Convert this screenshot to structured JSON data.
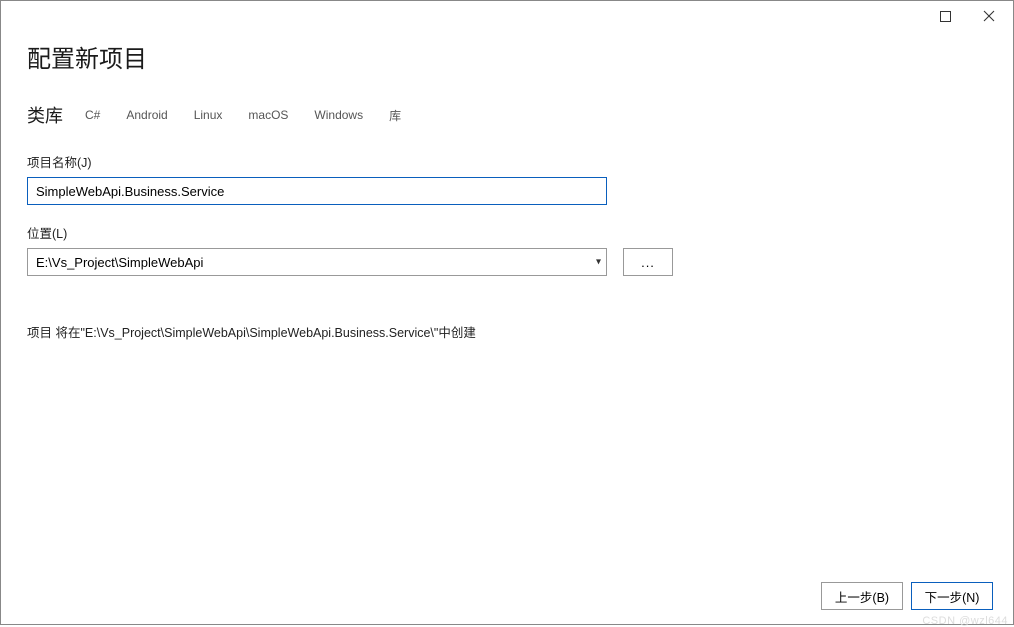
{
  "window": {
    "maximize_icon": "maximize",
    "close_icon": "close"
  },
  "heading": "配置新项目",
  "subheading": "类库",
  "tags": [
    "C#",
    "Android",
    "Linux",
    "macOS",
    "Windows",
    "库"
  ],
  "fields": {
    "name_label": "项目名称(J)",
    "name_value": "SimpleWebApi.Business.Service",
    "location_label": "位置(L)",
    "location_value": "E:\\Vs_Project\\SimpleWebApi",
    "browse_label": "..."
  },
  "info_text": "项目 将在\"E:\\Vs_Project\\SimpleWebApi\\SimpleWebApi.Business.Service\\\"中创建",
  "footer": {
    "back_label": "上一步(B)",
    "next_label": "下一步(N)"
  },
  "watermark": "CSDN @wzl644"
}
